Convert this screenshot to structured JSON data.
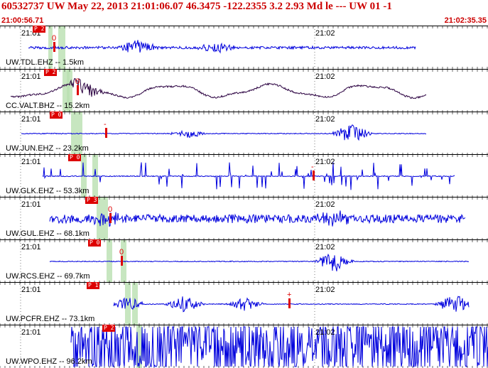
{
  "header": {
    "title": "60532737 UW May 22, 2013 21:01:06.07   46.3475 -122.2355  3.2 2.93 Md le --- UW 01  -1",
    "start_time": "21:00:56.71",
    "end_time": "21:02:35.35"
  },
  "colors": {
    "trace": "#0000dd",
    "trace_alt": "#2a0040",
    "header_text": "#cc0000",
    "phase_marker": "#dd0000",
    "window_band": "#b9e0b0"
  },
  "time_labels": [
    "21:01",
    "21:02"
  ],
  "traces": [
    {
      "label": "UW.TDL.EHZ -- 1.5km",
      "phase": "P 2",
      "pick_mark": "0"
    },
    {
      "label": "CC.VALT.BHZ -- 15.2km",
      "phase": "P 2",
      "pick_mark": "0"
    },
    {
      "label": "UW.JUN.EHZ -- 23.2km",
      "phase": "P 0",
      "pick_mark": "-"
    },
    {
      "label": "UW.GLK.EHZ -- 53.3km",
      "phase": "P 0",
      "pick_mark": "-"
    },
    {
      "label": "UW.GUL.EHZ -- 68.1km",
      "phase": "P 3",
      "pick_mark": "0"
    },
    {
      "label": "UW.RCS.EHZ -- 69.7km",
      "phase": "P 0",
      "pick_mark": "0"
    },
    {
      "label": "UW.PCFR.EHZ -- 73.1km",
      "phase": "P 1",
      "pick_mark": "+"
    },
    {
      "label": "UW.WPO.EHZ -- 96.2km",
      "phase": "P 2",
      "pick_mark": ""
    }
  ]
}
